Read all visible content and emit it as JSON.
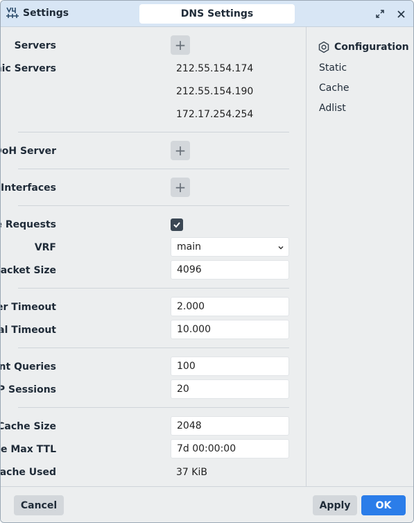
{
  "window": {
    "app_title": "Settings",
    "tab_title": "DNS Settings",
    "app_icon": "winbox-icon",
    "expand_icon": "expand-icon",
    "close_icon": "close-icon"
  },
  "form": {
    "servers_label": "Servers",
    "dynamic_servers_label": "Dynamic Servers",
    "dynamic_servers": [
      "212.55.154.174",
      "212.55.154.190",
      "172.17.254.254"
    ],
    "use_doh_label": "Use DoH Server",
    "mdns_label": "mDNS Repeater Interfaces",
    "allow_remote_label": "Allow Remote Requests",
    "allow_remote_checked": true,
    "vrf_label": "VRF",
    "vrf_value": "main",
    "max_udp_label": "Max UDP Packet Size",
    "max_udp_value": "4096",
    "query_server_timeout_label": "Query Server Timeout",
    "query_server_timeout_value": "2.000",
    "query_total_timeout_label": "Query Total Timeout",
    "query_total_timeout_value": "10.000",
    "max_concurrent_queries_label": "Max. Concurrent Queries",
    "max_concurrent_queries_value": "100",
    "max_concurrent_tcp_label": "Max. Concurrent TCP Sessions",
    "max_concurrent_tcp_value": "20",
    "cache_size_label": "Cache Size",
    "cache_size_value": "2048",
    "cache_max_ttl_label": "Cache Max TTL",
    "cache_max_ttl_value": "7d 00:00:00",
    "cache_used_label": "Cache Used",
    "cache_used_value": "37 KiB"
  },
  "sidebar": {
    "title": "Configuration",
    "icon": "hexagon-gear-icon",
    "items": [
      "Static",
      "Cache",
      "Adlist"
    ]
  },
  "footer": {
    "cancel_label": "Cancel",
    "apply_label": "Apply",
    "ok_label": "OK"
  },
  "colors": {
    "titlebar": "#d8e6f5",
    "accent": "#2b7de9",
    "panel": "#eceeef"
  }
}
